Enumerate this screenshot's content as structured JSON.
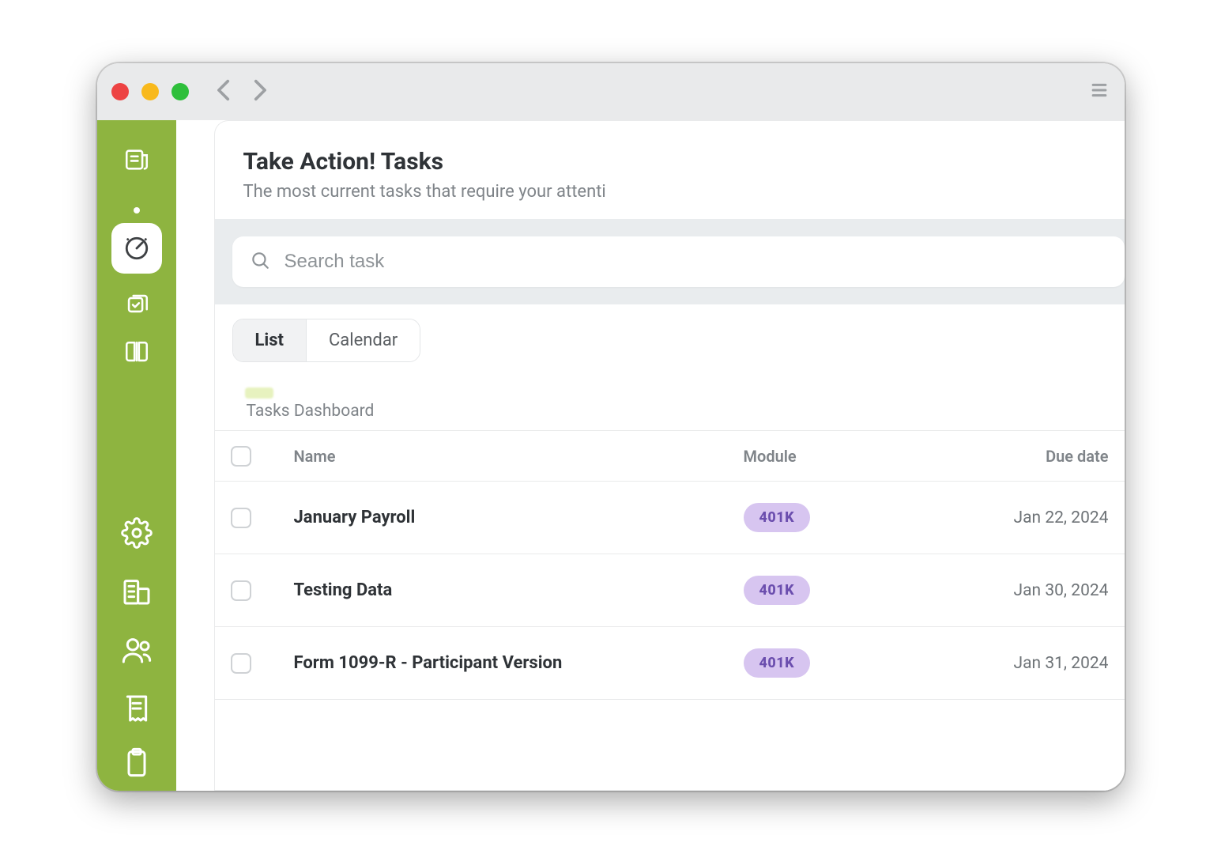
{
  "colors": {
    "sidebar": "#8eb440",
    "badge_bg": "#d7c5f0",
    "badge_text": "#6b4eae"
  },
  "header": {
    "title": "Take Action! Tasks",
    "subtitle": "The most current tasks that require your attenti"
  },
  "search": {
    "placeholder": "Search task"
  },
  "tabs": {
    "list": "List",
    "calendar": "Calendar"
  },
  "section": {
    "label": "Tasks Dashboard"
  },
  "table": {
    "columns": {
      "name": "Name",
      "module": "Module",
      "due": "Due date"
    },
    "rows": [
      {
        "name": "January Payroll",
        "module": "401K",
        "due": "Jan 22, 2024"
      },
      {
        "name": "Testing Data",
        "module": "401K",
        "due": "Jan 30, 2024"
      },
      {
        "name": "Form 1099-R - Participant Version",
        "module": "401K",
        "due": "Jan 31, 2024"
      }
    ]
  },
  "sidebar": {
    "top": [
      {
        "name": "news-icon"
      }
    ],
    "active": {
      "name": "gauge-icon"
    },
    "after_active": [
      {
        "name": "checklist-icon"
      },
      {
        "name": "book-icon"
      }
    ],
    "bottom": [
      {
        "name": "gear-icon"
      },
      {
        "name": "building-icon"
      },
      {
        "name": "users-icon"
      },
      {
        "name": "receipt-icon"
      },
      {
        "name": "clipboard-icon"
      }
    ]
  }
}
